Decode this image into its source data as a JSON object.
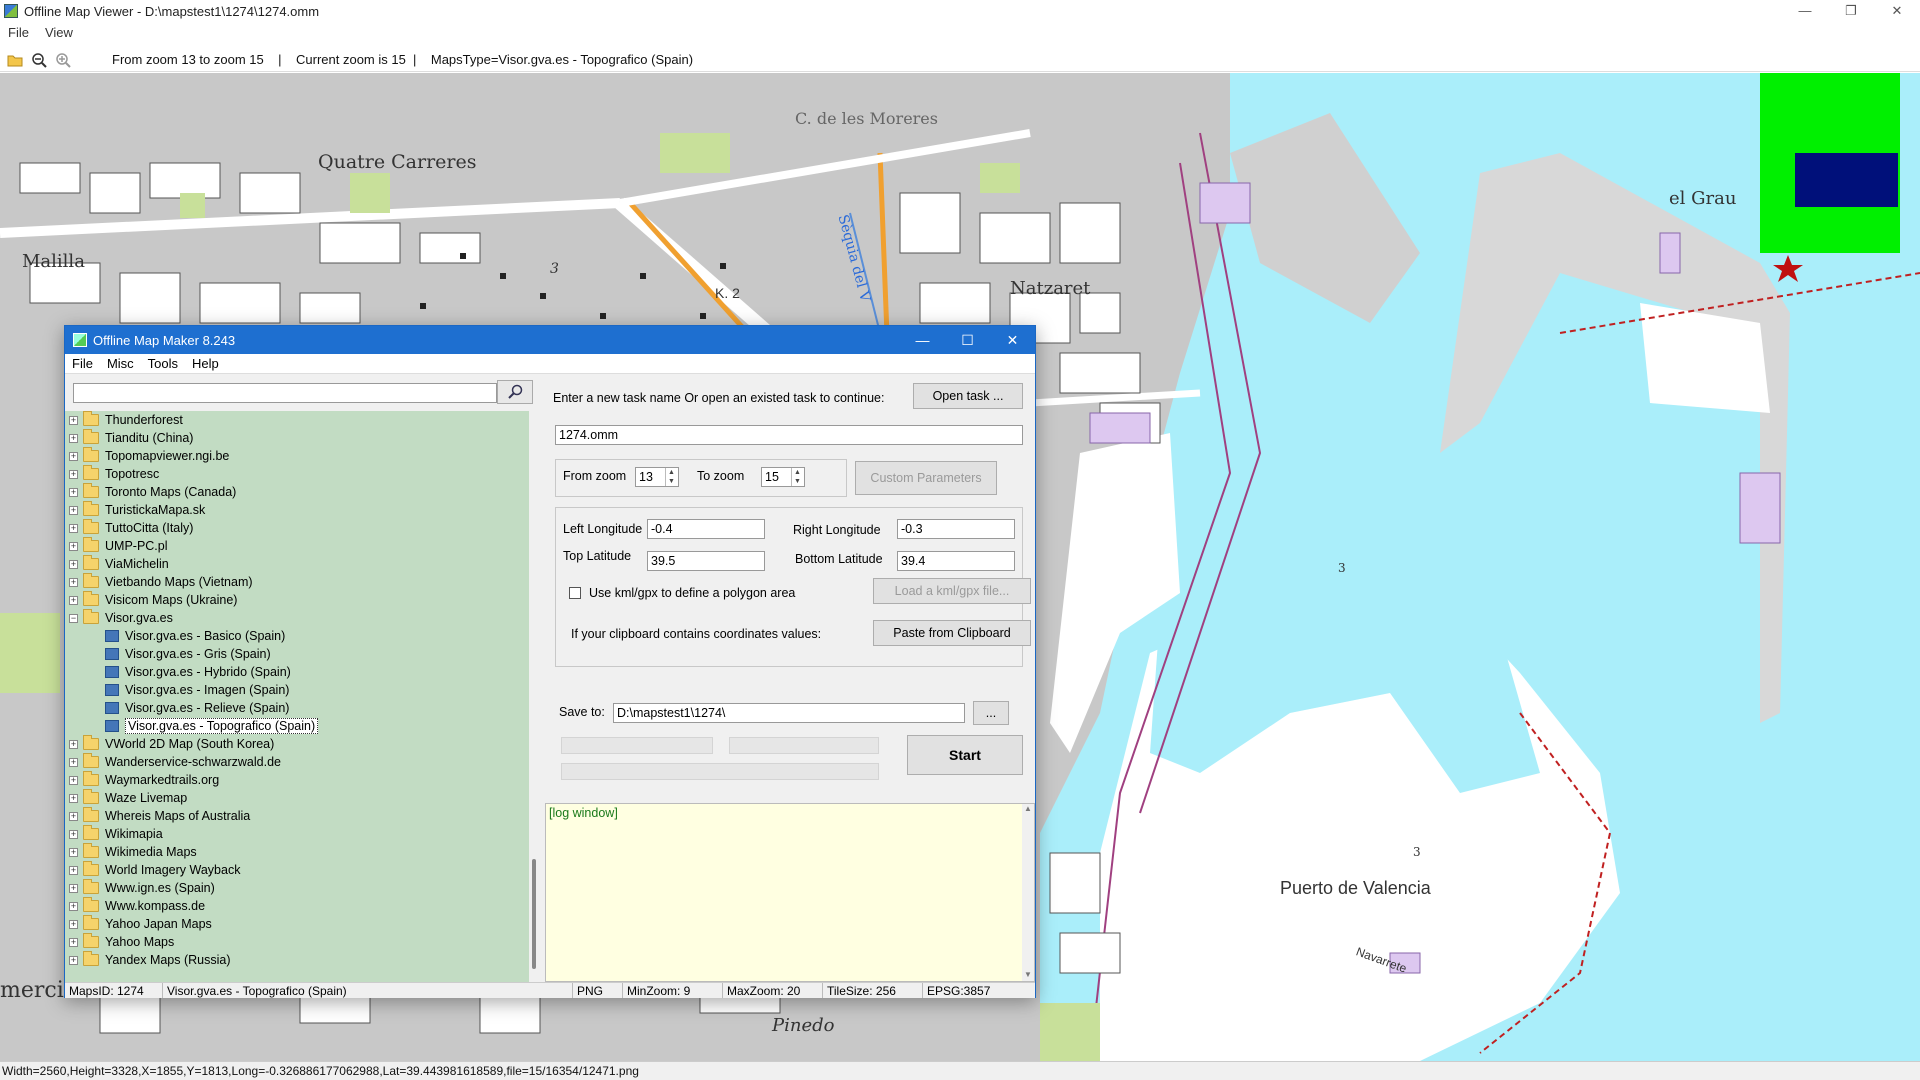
{
  "app": {
    "title": "Offline Map Viewer - D:\\mapstest1\\1274\\1274.omm",
    "menu": [
      "File",
      "View"
    ],
    "window_controls": [
      "—",
      "❐",
      "✕"
    ],
    "toolbar_info": "From zoom 13 to zoom 15    |    Current zoom is 15  |    MapsType=Visor.gva.es - Topografico (Spain)",
    "status": "Width=2560,Height=3328,X=1855,Y=1813,Long=-0.326886177062988,Lat=39.443981618589,file=15/16354/12471.png"
  },
  "map": {
    "labels": {
      "quatre": "Quatre Carreres",
      "moreres": "C. de les Moreres",
      "malilla": "Malilla",
      "nazaret": "Natzaret",
      "grau": "el Grau",
      "puerto": "Puerto de Valencia",
      "pinedo": "Pinedo",
      "sequia": "Sèquia del V",
      "k2": "K. 2",
      "navarrete": "Navarrete",
      "num3a": "3",
      "num3b": "3",
      "num3c": "3",
      "mercial": "mercial"
    }
  },
  "dialog": {
    "title": "Offline Map Maker 8.243",
    "menu": [
      "File",
      "Misc",
      "Tools",
      "Help"
    ],
    "search_value": "",
    "tree": [
      {
        "label": "Thunderforest",
        "type": "folder"
      },
      {
        "label": "Tianditu (China)",
        "type": "folder"
      },
      {
        "label": "Topomapviewer.ngi.be",
        "type": "folder"
      },
      {
        "label": "Topotresc",
        "type": "folder"
      },
      {
        "label": "Toronto Maps (Canada)",
        "type": "folder"
      },
      {
        "label": "TuristickaMapa.sk",
        "type": "folder"
      },
      {
        "label": "TuttoCitta (Italy)",
        "type": "folder"
      },
      {
        "label": "UMP-PC.pl",
        "type": "folder"
      },
      {
        "label": "ViaMichelin",
        "type": "folder"
      },
      {
        "label": "Vietbando Maps (Vietnam)",
        "type": "folder"
      },
      {
        "label": "Visicom Maps (Ukraine)",
        "type": "folder"
      },
      {
        "label": "Visor.gva.es",
        "type": "folder-open"
      },
      {
        "label": "Visor.gva.es - Basico (Spain)",
        "type": "map"
      },
      {
        "label": "Visor.gva.es - Gris (Spain)",
        "type": "map"
      },
      {
        "label": "Visor.gva.es - Hybrido (Spain)",
        "type": "map"
      },
      {
        "label": "Visor.gva.es - Imagen (Spain)",
        "type": "map"
      },
      {
        "label": "Visor.gva.es - Relieve (Spain)",
        "type": "map"
      },
      {
        "label": "Visor.gva.es - Topografico (Spain)",
        "type": "map-selected"
      },
      {
        "label": "VWorld 2D Map (South Korea)",
        "type": "folder"
      },
      {
        "label": "Wanderservice-schwarzwald.de",
        "type": "folder"
      },
      {
        "label": "Waymarkedtrails.org",
        "type": "folder"
      },
      {
        "label": "Waze Livemap",
        "type": "folder"
      },
      {
        "label": "Whereis Maps of Australia",
        "type": "folder"
      },
      {
        "label": "Wikimapia",
        "type": "folder"
      },
      {
        "label": "Wikimedia Maps",
        "type": "folder"
      },
      {
        "label": "World Imagery Wayback",
        "type": "folder"
      },
      {
        "label": "Www.ign.es (Spain)",
        "type": "folder"
      },
      {
        "label": "Www.kompass.de",
        "type": "folder"
      },
      {
        "label": "Yahoo Japan Maps",
        "type": "folder"
      },
      {
        "label": "Yahoo Maps",
        "type": "folder"
      },
      {
        "label": "Yandex Maps (Russia)",
        "type": "folder"
      }
    ],
    "task_prompt": "Enter a new task name Or open an existed task to continue:",
    "open_task": "Open task ...",
    "task_name": "1274.omm",
    "from_zoom_label": "From zoom",
    "from_zoom": "13",
    "to_zoom_label": "To zoom",
    "to_zoom": "15",
    "custom_params": "Custom Parameters",
    "left_lon_label": "Left Longitude",
    "left_lon": "-0.4",
    "right_lon_label": "Right Longitude",
    "right_lon": "-0.3",
    "top_lat_label": "Top Latitude",
    "top_lat": "39.5",
    "bottom_lat_label": "Bottom Latitude",
    "bottom_lat": "39.4",
    "use_kml_label": "Use kml/gpx to define a polygon area",
    "load_kml": "Load a kml/gpx file...",
    "clipboard_label": "If your clipboard contains coordinates values:",
    "paste_clipboard": "Paste from Clipboard",
    "save_to_label": "Save to:",
    "save_to": "D:\\mapstest1\\1274\\",
    "browse": "...",
    "start": "Start",
    "log": "[log window]",
    "status": {
      "maps_id": "MapsID: 1274",
      "maps_name": "Visor.gva.es - Topografico (Spain)",
      "format": "PNG",
      "min_zoom": "MinZoom: 9",
      "max_zoom": "MaxZoom: 20",
      "tile_size": "TileSize: 256",
      "epsg": "EPSG:3857"
    }
  },
  "colors": {
    "sea": "#aaeefa",
    "land": "#c8c8c8",
    "tree_bg": "#c2dcc3",
    "title_blue": "#1e6fd0",
    "minimap_green": "#00f000",
    "minimap_navy": "#00107a"
  }
}
